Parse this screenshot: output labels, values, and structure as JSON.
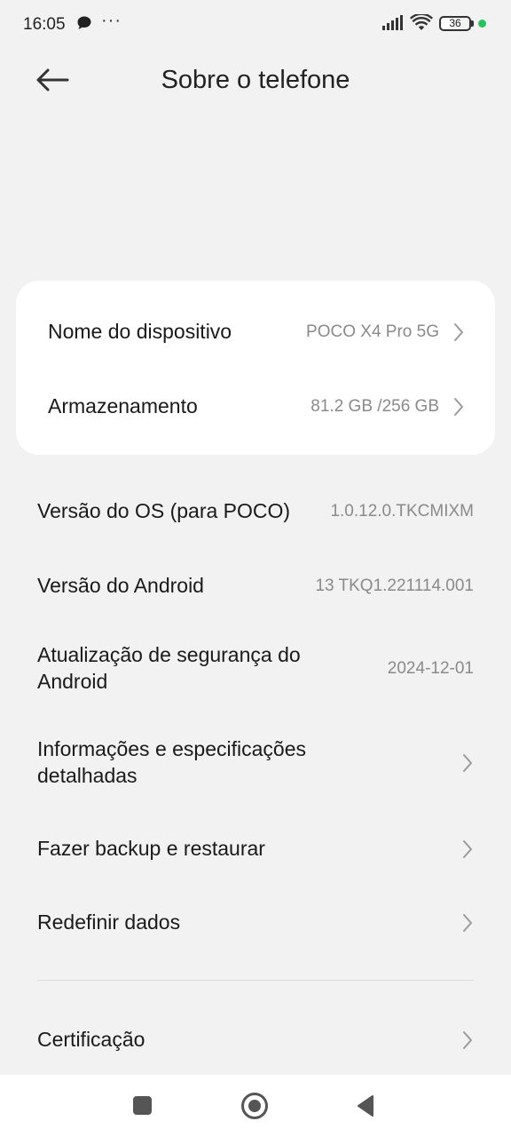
{
  "status_bar": {
    "time": "16:05",
    "dots": "···",
    "battery": "36",
    "icons": [
      "chat-bubble-icon",
      "signal-icon",
      "wifi-icon",
      "battery-icon"
    ]
  },
  "header": {
    "title": "Sobre o telefone",
    "back_icon": "arrow-left-icon"
  },
  "card": {
    "device_name": {
      "label": "Nome do dispositivo",
      "value": "POCO X4 Pro 5G"
    },
    "storage": {
      "label": "Armazenamento",
      "value": "81.2 GB /256 GB"
    }
  },
  "info": {
    "os_version": {
      "label": "Versão do OS (para POCO)",
      "value": "1.0.12.0.TKCMIXM"
    },
    "android_version": {
      "label": "Versão do Android",
      "value": "13 TKQ1.221114.001"
    },
    "security_update": {
      "label_line1": "Atualização de segurança do",
      "label_line2": "Android",
      "value": "2024-12-01"
    },
    "details": {
      "label_line1": "Informações e especificações",
      "label_line2": "detalhadas"
    },
    "backup": {
      "label": "Fazer backup e restaurar"
    },
    "reset": {
      "label": "Redefinir dados"
    },
    "certification": {
      "label": "Certificação"
    }
  },
  "colors": {
    "background": "#f2f2f2",
    "card": "#ffffff",
    "text": "#1a1a1a",
    "secondary_text": "#8a8a8a",
    "accent_dot": "#27c45a"
  }
}
